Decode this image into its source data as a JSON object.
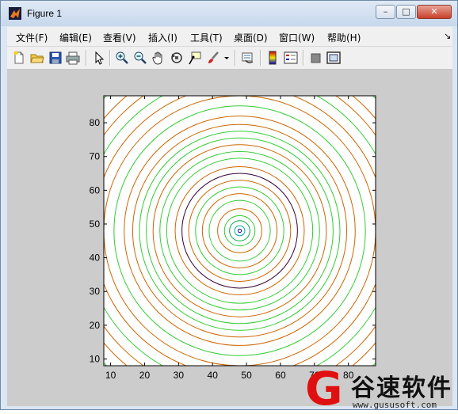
{
  "window": {
    "title": "Figure 1",
    "controls": {
      "minimize": "–",
      "maximize": "□",
      "close": "✕"
    }
  },
  "menu": {
    "items": [
      "文件(F)",
      "编辑(E)",
      "查看(V)",
      "插入(I)",
      "工具(T)",
      "桌面(D)",
      "窗口(W)",
      "帮助(H)"
    ],
    "dock_glyph": "↘"
  },
  "toolbar": {
    "buttons": [
      "new-figure-icon",
      "open-file-icon",
      "save-icon",
      "print-icon",
      "edit-plot-arrow-icon",
      "zoom-in-icon",
      "zoom-out-icon",
      "pan-hand-icon",
      "rotate-3d-icon",
      "data-cursor-icon",
      "brush-icon",
      "link-plot-icon",
      "colorbar-icon",
      "legend-icon",
      "hide-plot-tools-icon",
      "show-plot-tools-icon"
    ]
  },
  "chart_data": {
    "type": "contour",
    "title": "",
    "xlabel": "",
    "ylabel": "",
    "xlim": [
      8,
      88
    ],
    "ylim": [
      8,
      88
    ],
    "x_ticks": [
      10,
      20,
      30,
      40,
      50,
      60,
      70,
      80
    ],
    "y_ticks": [
      10,
      20,
      30,
      40,
      50,
      60,
      70,
      80
    ],
    "x_tick_labels": [
      "10",
      "20",
      "30",
      "40",
      "50",
      "60",
      "70",
      "80"
    ],
    "y_tick_labels": [
      "10",
      "20",
      "30",
      "40",
      "50",
      "60",
      "70",
      "80"
    ],
    "center": [
      48,
      48
    ],
    "grid": false,
    "contours": [
      {
        "radius": 0.5,
        "color": "#0000cc"
      },
      {
        "radius": 1.5,
        "color": "#00aaaa"
      },
      {
        "radius": 3,
        "color": "#00aa44"
      },
      {
        "radius": 4.5,
        "color": "#33cc33"
      },
      {
        "radius": 6.5,
        "color": "#cc6600"
      },
      {
        "radius": 9,
        "color": "#33cc33"
      },
      {
        "radius": 11,
        "color": "#cc6600"
      },
      {
        "radius": 13,
        "color": "#33cc33"
      },
      {
        "radius": 15,
        "color": "#cc6600"
      },
      {
        "radius": 17,
        "color": "#330033"
      },
      {
        "radius": 19,
        "color": "#cc6600"
      },
      {
        "radius": 21.5,
        "color": "#33cc33"
      },
      {
        "radius": 23.5,
        "color": "#33cc33"
      },
      {
        "radius": 25.5,
        "color": "#cc6600"
      },
      {
        "radius": 27.5,
        "color": "#33cc33"
      },
      {
        "radius": 29.5,
        "color": "#33cc33"
      },
      {
        "radius": 31.5,
        "color": "#cc6600"
      },
      {
        "radius": 34,
        "color": "#cc6600"
      },
      {
        "radius": 37,
        "color": "#33cc33"
      },
      {
        "radius": 40,
        "color": "#cc6600"
      },
      {
        "radius": 43,
        "color": "#cc6600"
      },
      {
        "radius": 46,
        "color": "#33cc33"
      },
      {
        "radius": 49,
        "color": "#cc6600"
      },
      {
        "radius": 52,
        "color": "#cc6600"
      },
      {
        "radius": 56,
        "color": "#33cc33"
      }
    ]
  },
  "watermark": {
    "logo_letter": "G",
    "text": "谷速软件",
    "url": "www.gususoft.com",
    "color": "#e01010"
  }
}
